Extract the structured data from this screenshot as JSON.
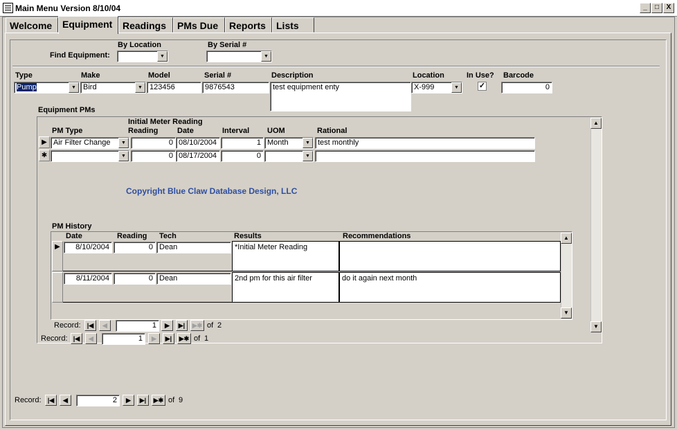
{
  "window": {
    "title": "Main Menu Version 8/10/04",
    "minimize_label": "_",
    "maximize_label": "□",
    "close_label": "X"
  },
  "tabs": [
    {
      "label": "Welcome"
    },
    {
      "label": "Equipment"
    },
    {
      "label": "Readings"
    },
    {
      "label": "PMs Due"
    },
    {
      "label": "Reports"
    },
    {
      "label": "Lists"
    }
  ],
  "find": {
    "label": "Find Equipment:",
    "by_location_label": "By Location",
    "by_serial_label": "By Serial #",
    "by_location_value": "",
    "by_serial_value": ""
  },
  "equipment": {
    "labels": {
      "type": "Type",
      "make": "Make",
      "model": "Model",
      "serial": "Serial #",
      "description": "Description",
      "location": "Location",
      "in_use": "In Use?",
      "barcode": "Barcode"
    },
    "values": {
      "type": "Pump",
      "make": "Bird",
      "model": "123456",
      "serial": "9876543",
      "description": "test equipment enty",
      "location": "X-999",
      "in_use": "✓",
      "barcode": "0"
    }
  },
  "pms": {
    "section_label": "Equipment PMs",
    "headers": {
      "pm_type": "PM Type",
      "initial_meter": "Initial Meter Reading",
      "reading": "Reading",
      "date": "Date",
      "interval": "Interval",
      "uom": "UOM",
      "rational": "Rational"
    },
    "rows": [
      {
        "selector": "▶",
        "pm_type": "Air Filter Change",
        "reading": "0",
        "date": "08/10/2004",
        "interval": "1",
        "uom": "Month",
        "rational": "test monthly"
      },
      {
        "selector": "✱",
        "pm_type": "",
        "reading": "0",
        "date": "08/17/2004",
        "interval": "0",
        "uom": "",
        "rational": ""
      }
    ],
    "copyright": "Copyright Blue Claw Database Design, LLC",
    "nav": {
      "label": "Record:",
      "current": "1",
      "of": "of",
      "total": "1"
    }
  },
  "history": {
    "section_label": "PM History",
    "headers": {
      "date": "Date",
      "reading": "Reading",
      "tech": "Tech",
      "results": "Results",
      "recommendations": "Recommendations"
    },
    "rows": [
      {
        "selector": "▶",
        "date": "8/10/2004",
        "reading": "0",
        "tech": "Dean",
        "results": "*Initial Meter Reading",
        "recommendations": ""
      },
      {
        "selector": "",
        "date": "8/11/2004",
        "reading": "0",
        "tech": "Dean",
        "results": "2nd pm for this air filter",
        "recommendations": "do it again next month"
      }
    ],
    "nav": {
      "label": "Record:",
      "current": "1",
      "of": "of",
      "total": "2"
    }
  },
  "main_nav": {
    "label": "Record:",
    "current": "2",
    "of": "of",
    "total": "9"
  },
  "icons": {
    "first": "|◀",
    "prev": "◀",
    "next": "▶",
    "last": "▶|",
    "new": "▶✱",
    "dropdown": "▼",
    "scroll_up": "▲",
    "scroll_down": "▼"
  }
}
